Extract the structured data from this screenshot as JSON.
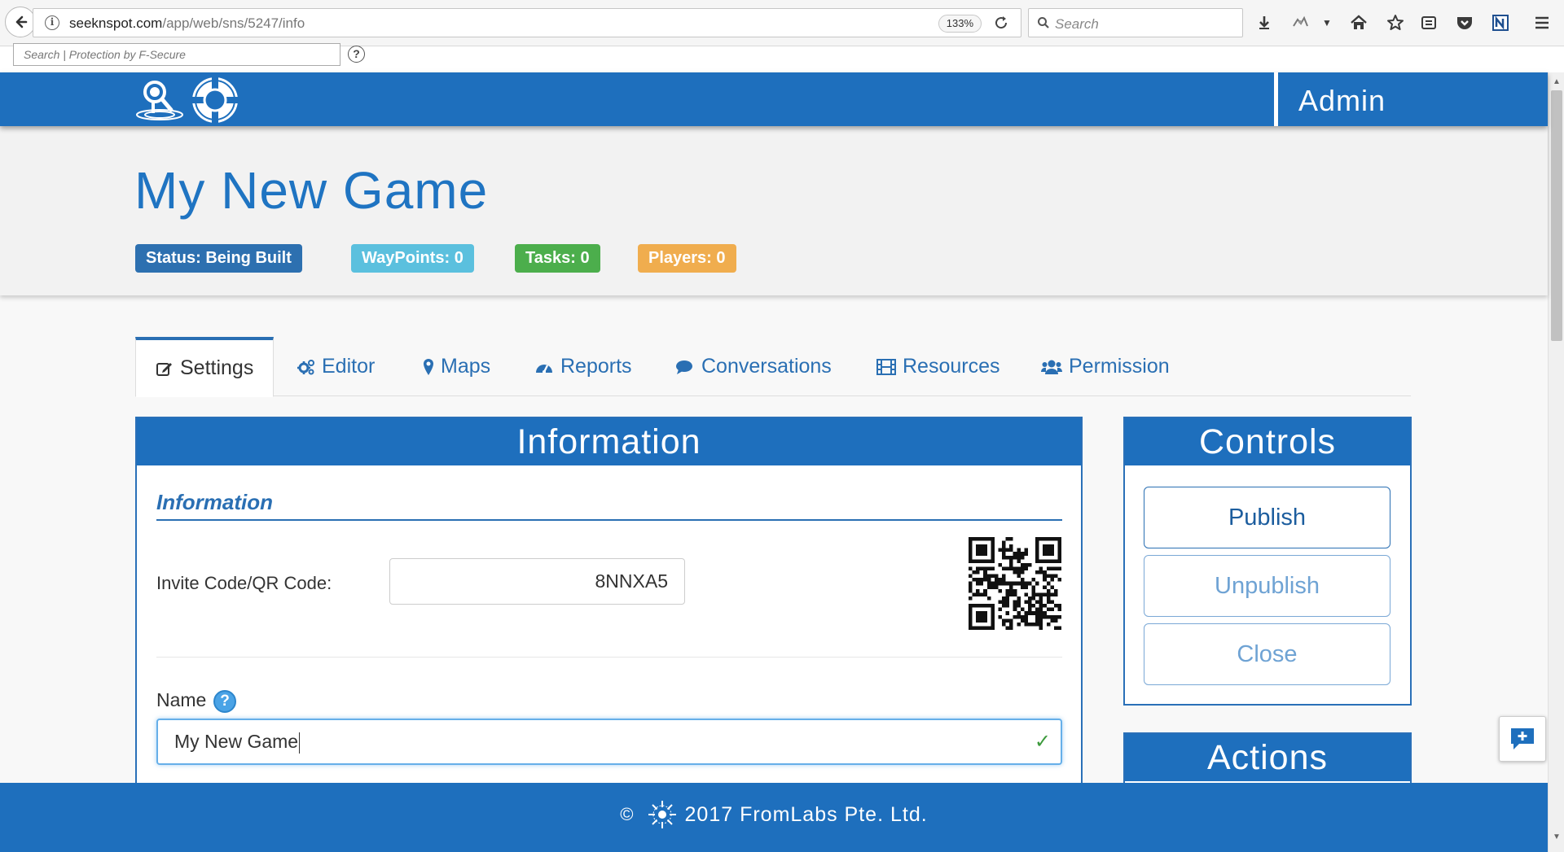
{
  "browser": {
    "url_host": "seeknspot.com",
    "url_path": "/app/web/sns/5247/info",
    "zoom": "133%",
    "search_placeholder": "Search",
    "fsecure_placeholder": "Search | Protection by F-Secure",
    "help_glyph": "?"
  },
  "header": {
    "user_label": "Admin"
  },
  "game": {
    "title": "My New Game",
    "badges": {
      "status": "Status:  Being Built",
      "waypoints": "WayPoints: 0",
      "tasks": "Tasks: 0",
      "players": "Players: 0"
    }
  },
  "tabs": [
    {
      "label": "Settings",
      "icon": "edit-icon",
      "active": true
    },
    {
      "label": "Editor",
      "icon": "cogs-icon"
    },
    {
      "label": "Maps",
      "icon": "map-marker-icon"
    },
    {
      "label": "Reports",
      "icon": "dashboard-icon"
    },
    {
      "label": "Conversations",
      "icon": "comments-icon"
    },
    {
      "label": "Resources",
      "icon": "film-icon"
    },
    {
      "label": "Permission",
      "icon": "users-icon"
    }
  ],
  "info_panel": {
    "heading": "Information",
    "section_title": "Information",
    "invite_label": "Invite Code/QR Code:",
    "invite_code": "8NNXA5",
    "name_label": "Name",
    "name_help": "?",
    "name_value": "My New Game"
  },
  "controls_panel": {
    "heading": "Controls",
    "publish": "Publish",
    "unpublish": "Unpublish",
    "close": "Close"
  },
  "actions_panel": {
    "heading": "Actions"
  },
  "footer": {
    "copyright_symbol": "©",
    "text": "2017 FromLabs Pte. Ltd."
  },
  "colors": {
    "brand_blue": "#1e6fbd",
    "status": "#2d70b0",
    "waypoints": "#5bc0de",
    "tasks": "#4cae4c",
    "players": "#f0ad4e"
  }
}
